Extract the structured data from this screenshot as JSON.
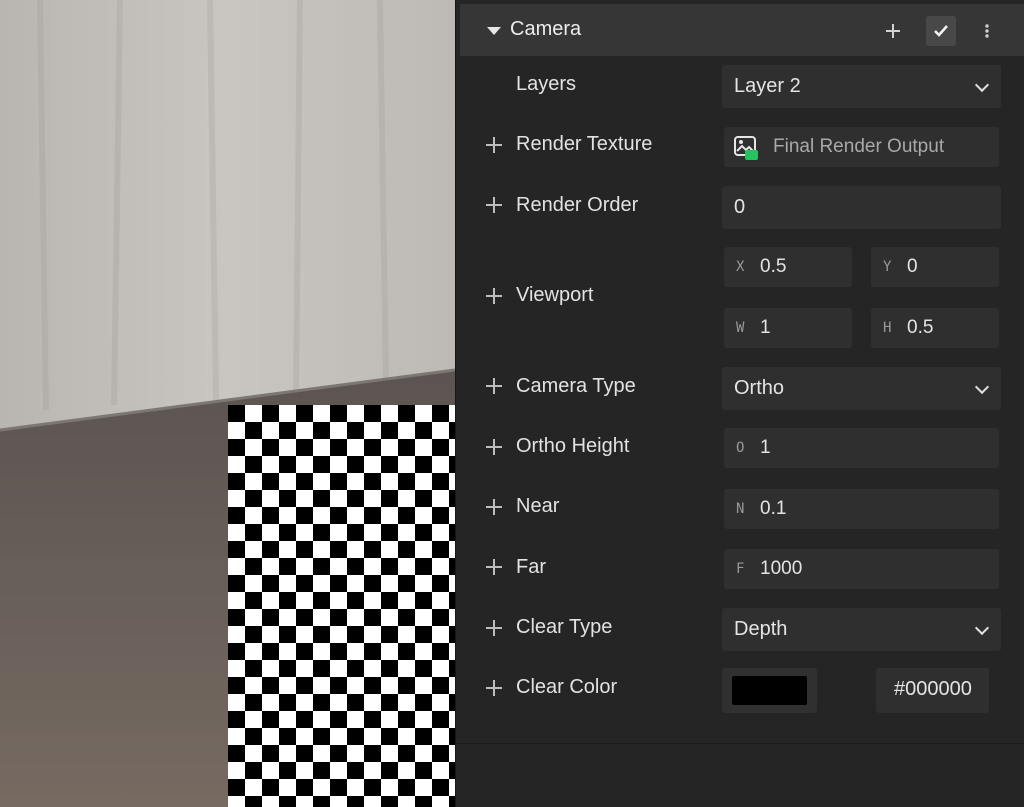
{
  "component": {
    "title": "Camera",
    "header_icons": [
      "caret-down-icon",
      "plus-icon",
      "check-icon",
      "more-vertical-icon"
    ]
  },
  "rows": {
    "layers": {
      "label": "Layers",
      "value": "Layer 2"
    },
    "render_texture": {
      "label": "Render Texture",
      "value": "Final Render Output"
    },
    "render_order": {
      "label": "Render Order",
      "value": "0"
    },
    "viewport": {
      "label": "Viewport",
      "x": {
        "axis": "X",
        "value": "0.5"
      },
      "y": {
        "axis": "Y",
        "value": "0"
      },
      "w": {
        "axis": "W",
        "value": "1"
      },
      "h": {
        "axis": "H",
        "value": "0.5"
      }
    },
    "camera_type": {
      "label": "Camera Type",
      "value": "Ortho"
    },
    "ortho_height": {
      "label": "Ortho Height",
      "axis": "O",
      "value": "1"
    },
    "near": {
      "label": "Near",
      "axis": "N",
      "value": "0.1"
    },
    "far": {
      "label": "Far",
      "axis": "F",
      "value": "1000"
    },
    "clear_type": {
      "label": "Clear Type",
      "value": "Depth"
    },
    "clear_color": {
      "label": "Clear Color",
      "hex": "#000000",
      "swatch": "#000000"
    }
  },
  "colors": {
    "panel_bg": "#252525",
    "header_bg": "#363636",
    "field_bg": "#2f2f2f",
    "text": "#e2e2e2",
    "texture_icon_accent": "#22c55e"
  }
}
